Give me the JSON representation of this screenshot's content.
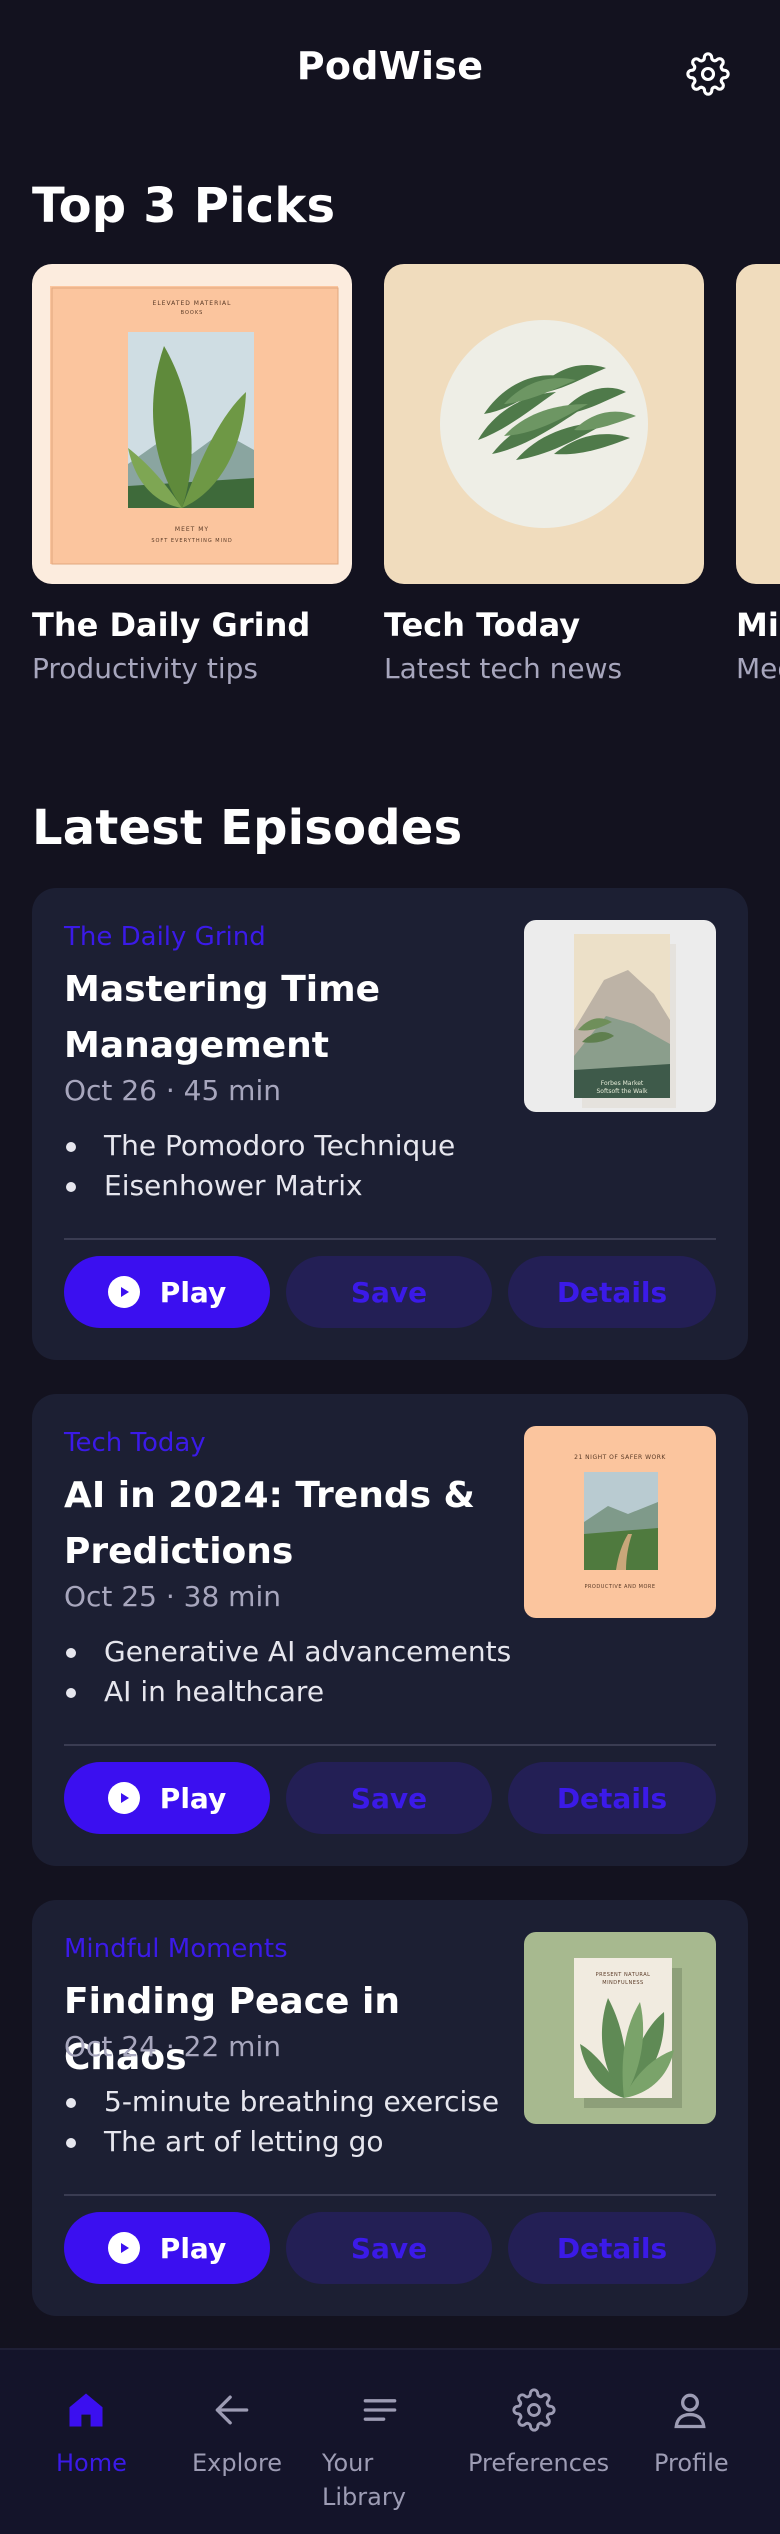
{
  "header": {
    "title": "PodWise",
    "settings_icon": "gear-icon"
  },
  "top_picks": {
    "heading": "Top 3 Picks",
    "items": [
      {
        "title": "The Daily Grind",
        "subtitle": "Productivity tips",
        "cover_color": "#fbc59e",
        "cover_top_text": "ELEVATED MATERIAL",
        "cover_top_sub": "BOOKS",
        "cover_bottom_text": "MEET MY",
        "cover_bottom_sub": "SOFT EVERYTHING MIND"
      },
      {
        "title": "Tech Today",
        "subtitle": "Latest tech news",
        "cover_color": "#f0dcbd"
      },
      {
        "title": "Mindful Moments",
        "subtitle": "Meditation",
        "cover_color": "#f0dcbd"
      }
    ]
  },
  "latest": {
    "heading": "Latest Episodes",
    "episodes": [
      {
        "show": "The Daily Grind",
        "title": "Mastering Time Management",
        "meta": "Oct 26 · 45 min",
        "bullets": [
          "The Pomodoro Technique",
          "Eisenhower Matrix"
        ],
        "thumb_color": "#ececec",
        "thumb_text_1": "Forbes Market",
        "thumb_text_2": "Softsoft the Walk",
        "play": "Play",
        "save": "Save",
        "details": "Details"
      },
      {
        "show": "Tech Today",
        "title": "AI in 2024: Trends & Predictions",
        "meta": "Oct 25 · 38 min",
        "bullets": [
          "Generative AI advancements",
          "AI in healthcare"
        ],
        "thumb_color": "#fbc59e",
        "thumb_text_1": "21 NIGHT OF SAFER WORK",
        "thumb_text_2": "PRODUCTIVE AND MORE",
        "play": "Play",
        "save": "Save",
        "details": "Details"
      },
      {
        "show": "Mindful Moments",
        "title": "Finding Peace in Chaos",
        "meta": "Oct 24 · 22 min",
        "bullets": [
          "5-minute breathing exercise",
          "The art of letting go"
        ],
        "thumb_color": "#a7b98f",
        "thumb_text_1": "PRESENT NATURAL",
        "thumb_text_2": "MINDFULNESS",
        "play": "Play",
        "save": "Save",
        "details": "Details"
      }
    ]
  },
  "nav": {
    "items": [
      {
        "label": "Home",
        "icon": "home-icon",
        "active": true
      },
      {
        "label": "Explore",
        "icon": "arrow-left-icon",
        "active": false
      },
      {
        "label": "Your Library",
        "icon": "library-icon",
        "active": false
      },
      {
        "label": "Preferences",
        "icon": "gear-icon",
        "active": false
      },
      {
        "label": "Profile",
        "icon": "person-icon",
        "active": false
      }
    ]
  },
  "colors": {
    "accent": "#3b0ff0",
    "background": "#13121f",
    "card": "#1c1f33",
    "muted": "#a7a6bd"
  }
}
